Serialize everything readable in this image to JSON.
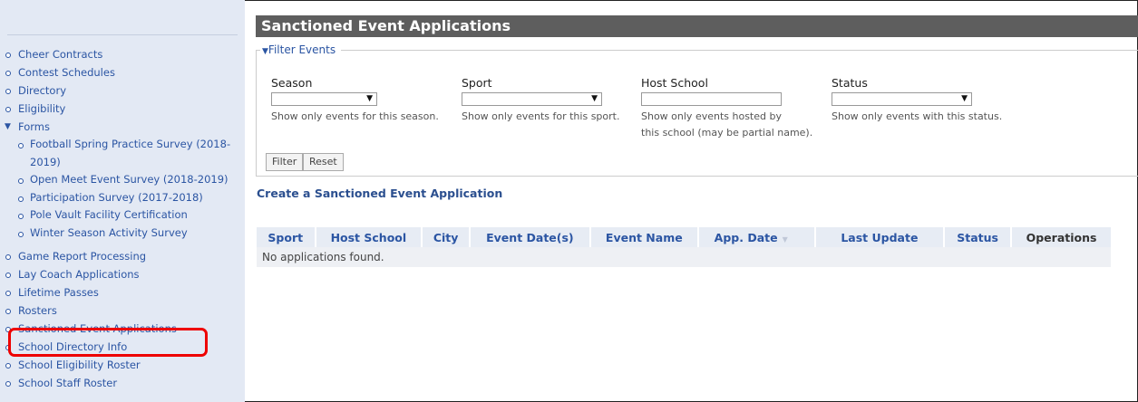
{
  "sidebar": {
    "items": [
      {
        "label": "Cheer Contracts"
      },
      {
        "label": "Contest Schedules"
      },
      {
        "label": "Directory"
      },
      {
        "label": "Eligibility"
      },
      {
        "label": "Forms",
        "expanded": true
      },
      {
        "label": "Game Report Processing"
      },
      {
        "label": "Lay Coach Applications"
      },
      {
        "label": "Lifetime Passes"
      },
      {
        "label": "Rosters"
      },
      {
        "label": "Sanctioned Event Applications",
        "highlighted": true
      },
      {
        "label": "School Directory Info"
      },
      {
        "label": "School Eligibility Roster"
      },
      {
        "label": "School Staff Roster"
      }
    ],
    "forms_subitems": [
      {
        "label": "Football Spring Practice Survey (2018-2019)"
      },
      {
        "label": "Open Meet Event Survey (2018-2019)"
      },
      {
        "label": "Participation Survey (2017-2018)"
      },
      {
        "label": "Pole Vault Facility Certification"
      },
      {
        "label": "Winter Season Activity Survey"
      }
    ]
  },
  "page": {
    "title": "Sanctioned Event Applications"
  },
  "filter": {
    "legend": "Filter Events",
    "season": {
      "label": "Season",
      "value": "",
      "help": "Show only events for this season."
    },
    "sport": {
      "label": "Sport",
      "value": "",
      "help": "Show only events for this sport."
    },
    "host_school": {
      "label": "Host School",
      "value": "",
      "help_line1": "Show only events hosted by",
      "help_line2": "this school (may be partial name)."
    },
    "status": {
      "label": "Status",
      "value": "",
      "help": "Show only events with this status."
    },
    "filter_button": "Filter",
    "reset_button": "Reset"
  },
  "create_link": "Create a Sanctioned Event Application",
  "table": {
    "columns": [
      "Sport",
      "Host School",
      "City",
      "Event Date(s)",
      "Event Name",
      "App. Date",
      "Last Update",
      "Status",
      "Operations"
    ],
    "empty_message": "No applications found."
  },
  "colors": {
    "sidebar_bg": "#e3e9f4",
    "link": "#2b55a3",
    "title_bar": "#5e5e5e",
    "highlight": "#ee0000"
  },
  "icons": {
    "bullet": "circle-bullet-icon",
    "expanded": "triangle-down-icon",
    "select_arrow": "dropdown-arrow-icon",
    "sort": "sort-desc-icon"
  }
}
